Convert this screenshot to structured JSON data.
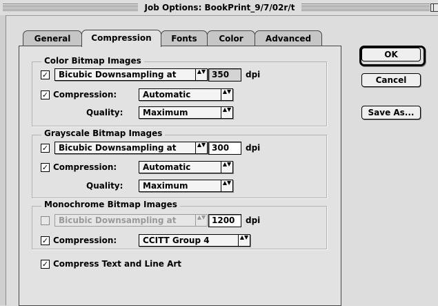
{
  "window": {
    "title": "Job Options: BookPrint_9/7/02r/t"
  },
  "tabs": [
    {
      "label": "General",
      "active": false
    },
    {
      "label": "Compression",
      "active": true
    },
    {
      "label": "Fonts",
      "active": false
    },
    {
      "label": "Color",
      "active": false
    },
    {
      "label": "Advanced",
      "active": false
    }
  ],
  "color_bitmap": {
    "title": "Color Bitmap Images",
    "downsample_checked": true,
    "downsample_method": "Bicubic Downsampling at",
    "resolution": "350",
    "unit": "dpi",
    "compression_label": "Compression:",
    "compression_checked": true,
    "compression": "Automatic",
    "quality_label": "Quality:",
    "quality": "Maximum"
  },
  "grayscale_bitmap": {
    "title": "Grayscale Bitmap Images",
    "downsample_checked": true,
    "downsample_method": "Bicubic Downsampling at",
    "resolution": "300",
    "unit": "dpi",
    "compression_label": "Compression:",
    "compression_checked": true,
    "compression": "Automatic",
    "quality_label": "Quality:",
    "quality": "Maximum"
  },
  "monochrome_bitmap": {
    "title": "Monochrome Bitmap Images",
    "downsample_checked": false,
    "downsample_method": "Bicubic Downsampling at",
    "resolution": "1200",
    "unit": "dpi",
    "compression_label": "Compression:",
    "compression_checked": true,
    "compression": "CCITT Group 4"
  },
  "compress_text": {
    "label": "Compress Text and Line Art",
    "checked": true
  },
  "buttons": {
    "ok": "OK",
    "cancel": "Cancel",
    "save_as": "Save As..."
  },
  "glyphs": {
    "check": "✓",
    "popup_arrows": "▲▼"
  }
}
